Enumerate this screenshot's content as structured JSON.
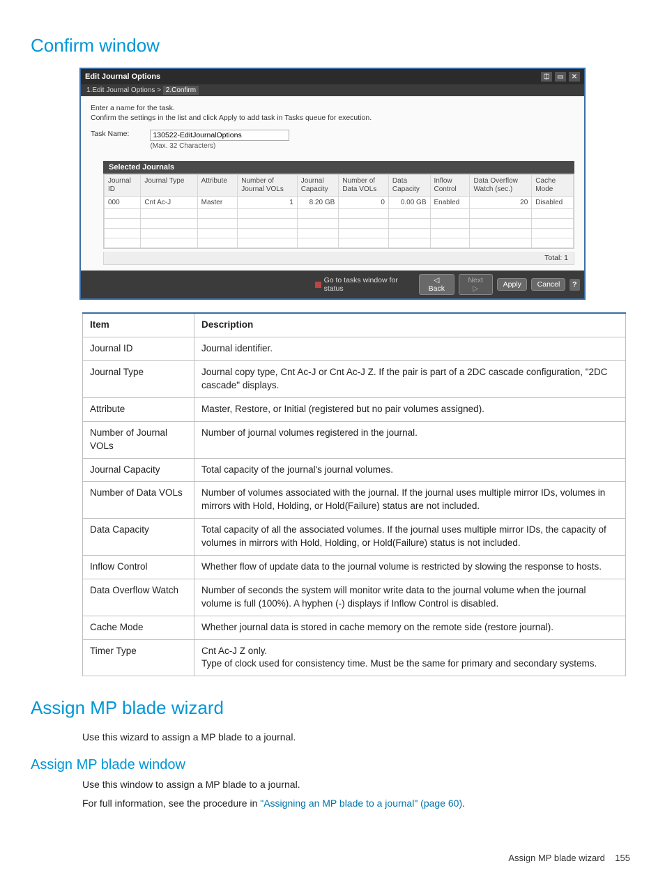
{
  "section1": {
    "title": "Confirm window"
  },
  "dialog": {
    "title": "Edit Journal Options",
    "step1": "1.Edit Journal Options",
    "step_sep": ">",
    "step2": "2.Confirm",
    "instr_line1": "Enter a name for the task.",
    "instr_line2": "Confirm the settings in the list and click Apply to add task in Tasks queue for execution.",
    "task_label": "Task Name:",
    "task_value": "130522-EditJournalOptions",
    "task_hint": "(Max. 32 Characters)",
    "sj_title": "Selected Journals",
    "sj_headers": {
      "c0": "Journal\nID",
      "c1": "Journal Type",
      "c2": "Attribute",
      "c3": "Number of\nJournal VOLs",
      "c4": "Journal\nCapacity",
      "c5": "Number of\nData VOLs",
      "c6": "Data\nCapacity",
      "c7": "Inflow\nControl",
      "c8": "Data Overflow\nWatch (sec.)",
      "c9": "Cache\nMode"
    },
    "sj_row": {
      "c0": "000",
      "c1": "Cnt Ac-J",
      "c2": "Master",
      "c3": "1",
      "c4": "8.20 GB",
      "c5": "0",
      "c6": "0.00 GB",
      "c7": "Enabled",
      "c8": "20",
      "c9": "Disabled"
    },
    "total_label": "Total: 1",
    "footer": {
      "status": "Go to tasks window for status",
      "back": "◁ Back",
      "next": "Next ▷",
      "apply": "Apply",
      "cancel": "Cancel",
      "help": "?"
    },
    "icons": {
      "filter": "⎅",
      "restore": "▭",
      "close": "✕"
    }
  },
  "desc": {
    "h_item": "Item",
    "h_desc": "Description",
    "rows": [
      {
        "item": "Journal ID",
        "desc": "Journal identifier."
      },
      {
        "item": "Journal Type",
        "desc": "Journal copy type, Cnt Ac-J or Cnt Ac-J Z. If the pair is part of a 2DC cascade configuration, \"2DC cascade\" displays."
      },
      {
        "item": "Attribute",
        "desc": "Master, Restore, or Initial (registered but no pair volumes assigned)."
      },
      {
        "item": "Number of Journal VOLs",
        "desc": "Number of journal volumes registered in the journal."
      },
      {
        "item": "Journal Capacity",
        "desc": "Total capacity of the journal's journal volumes."
      },
      {
        "item": "Number of Data VOLs",
        "desc": "Number of volumes associated with the journal. If the journal uses multiple mirror IDs, volumes in mirrors with Hold, Holding, or Hold(Failure) status are not included."
      },
      {
        "item": "Data Capacity",
        "desc": "Total capacity of all the associated volumes. If the journal uses multiple mirror IDs, the capacity of volumes in mirrors with Hold, Holding, or Hold(Failure) status is not included."
      },
      {
        "item": "Inflow Control",
        "desc": "Whether flow of update data to the journal volume is restricted by slowing the response to hosts."
      },
      {
        "item": "Data Overflow Watch",
        "desc": "Number of seconds the system will monitor write data to the journal volume when the journal volume is full (100%). A hyphen (-) displays if Inflow Control is disabled."
      },
      {
        "item": "Cache Mode",
        "desc": "Whether journal data is stored in cache memory on the remote side (restore journal)."
      },
      {
        "item": "Timer Type",
        "desc": "Cnt Ac-J Z only.\nType of clock used for consistency time. Must be the same for primary and secondary systems."
      }
    ]
  },
  "section2": {
    "title": "Assign MP blade wizard",
    "body": "Use this wizard to assign a MP blade to a journal."
  },
  "section3": {
    "title": "Assign MP blade window",
    "body1": "Use this window to assign a MP blade to a journal.",
    "body2_pre": "For full information, see the procedure in ",
    "body2_link": "\"Assigning an MP blade to a journal\" (page 60)",
    "body2_post": "."
  },
  "footer": {
    "left": "Assign MP blade wizard",
    "page": "155"
  }
}
